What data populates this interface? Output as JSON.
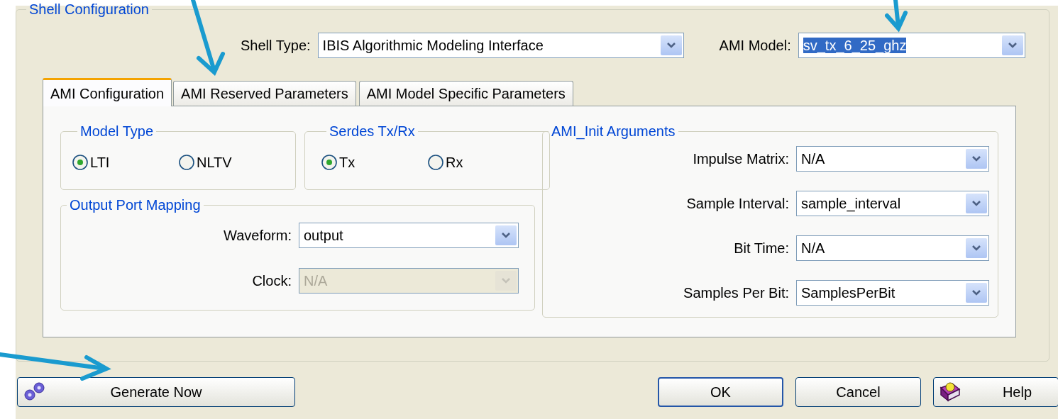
{
  "group": {
    "title": "Shell Configuration"
  },
  "shell_type": {
    "label": "Shell Type:",
    "value": "IBIS Algorithmic Modeling Interface"
  },
  "ami_model": {
    "label": "AMI Model:",
    "value": "sv_tx_6_25_ghz",
    "highlighted": true
  },
  "tabs": [
    {
      "label": "AMI Configuration",
      "selected": true
    },
    {
      "label": "AMI Reserved Parameters",
      "selected": false
    },
    {
      "label": "AMI Model Specific Parameters",
      "selected": false
    }
  ],
  "model_type": {
    "title": "Model Type",
    "options": [
      {
        "label": "LTI",
        "selected": true
      },
      {
        "label": "NLTV",
        "selected": false
      }
    ]
  },
  "serdes": {
    "title": "Serdes Tx/Rx",
    "options": [
      {
        "label": "Tx",
        "selected": true
      },
      {
        "label": "Rx",
        "selected": false
      }
    ]
  },
  "output_port_mapping": {
    "title": "Output Port Mapping",
    "fields": [
      {
        "label": "Waveform:",
        "value": "output",
        "disabled": false
      },
      {
        "label": "Clock:",
        "value": "N/A",
        "disabled": true
      }
    ]
  },
  "ami_init_arguments": {
    "title": "AMI_Init Arguments",
    "fields": [
      {
        "label": "Impulse Matrix:",
        "value": "N/A"
      },
      {
        "label": "Sample Interval:",
        "value": "sample_interval"
      },
      {
        "label": "Bit Time:",
        "value": "N/A"
      },
      {
        "label": "Samples Per Bit:",
        "value": "SamplesPerBit"
      }
    ]
  },
  "buttons": [
    {
      "label": "Generate Now",
      "kind": "gear"
    },
    {
      "label": "OK",
      "kind": "default"
    },
    {
      "label": "Cancel",
      "kind": "plain"
    },
    {
      "label": "Help",
      "kind": "help"
    }
  ]
}
